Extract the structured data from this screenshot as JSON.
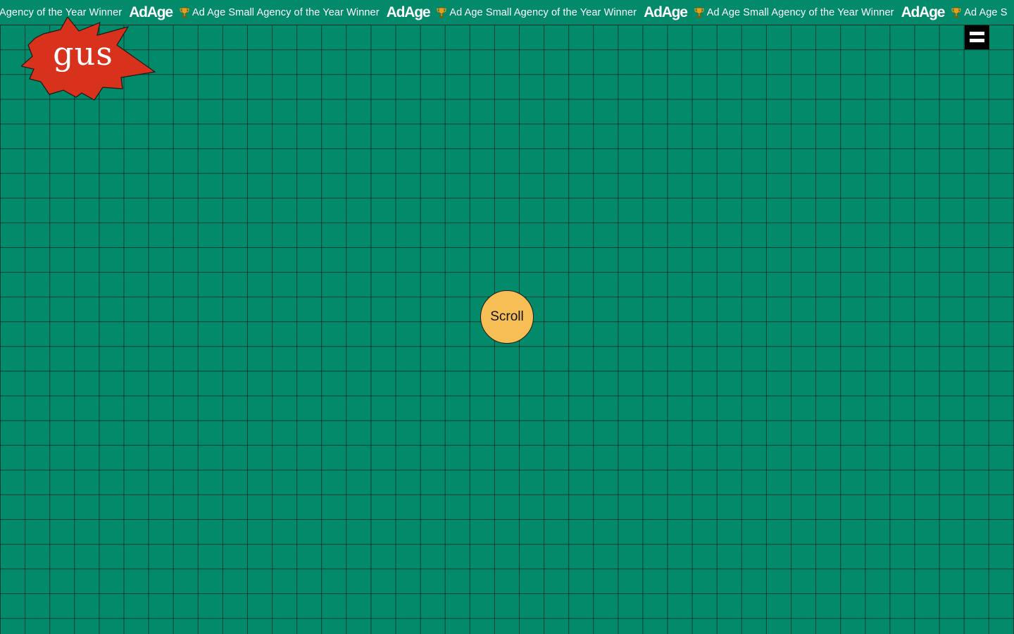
{
  "ticker": {
    "lead_text": "Agency of the Year Winner",
    "logo_text": "AdAge",
    "award_text": "Ad Age Small Agency of the Year Winner",
    "tail_text": "Ad Age S",
    "icon": "trophy-icon"
  },
  "brand": {
    "logo_text": "gus",
    "badge_shape": "starburst",
    "badge_color": "#d8311c"
  },
  "menu": {
    "icon": "hamburger-menu-icon"
  },
  "scroll_button": {
    "label": "Scroll",
    "color": "#f6be55"
  },
  "colors": {
    "background": "#028a6a",
    "grid_lines": "#000000",
    "ticker_text": "#ffffff"
  }
}
